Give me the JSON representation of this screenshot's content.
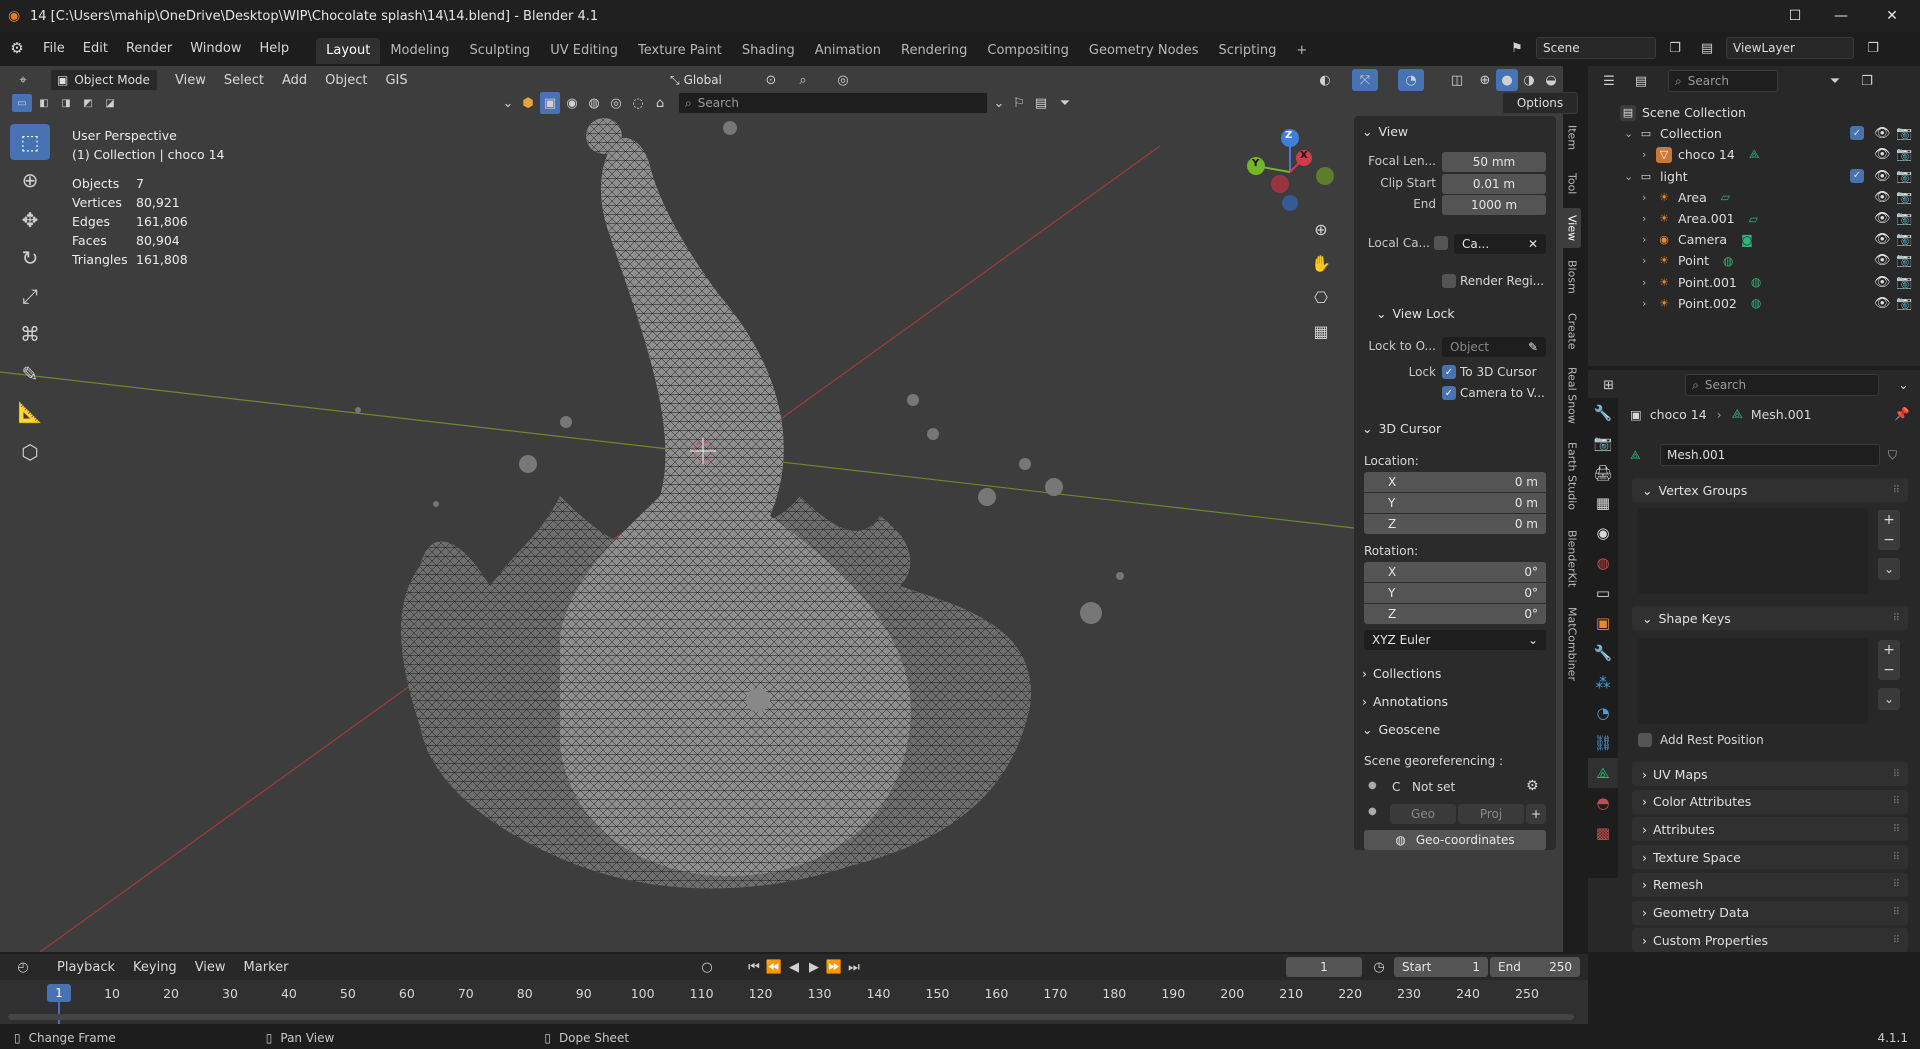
{
  "titlebar": {
    "title": "14 [C:\\Users\\mahip\\OneDrive\\Desktop\\WIP\\Chocolate splash\\14\\14.blend] - Blender 4.1",
    "minimize": "—",
    "maximize": "☐",
    "close": "✕"
  },
  "menu": {
    "items": [
      "File",
      "Edit",
      "Render",
      "Window",
      "Help"
    ],
    "workspaces": [
      "Layout",
      "Modeling",
      "Sculpting",
      "UV Editing",
      "Texture Paint",
      "Shading",
      "Animation",
      "Rendering",
      "Compositing",
      "Geometry Nodes",
      "Scripting"
    ],
    "add_tab": "+",
    "scene": "Scene",
    "view_layer": "ViewLayer"
  },
  "viewport_header": {
    "mode": "Object Mode",
    "menus": [
      "View",
      "Select",
      "Add",
      "Object",
      "GIS"
    ],
    "transform_orientation": "Global",
    "search_placeholder": "Search",
    "options": "Options"
  },
  "viewport": {
    "view_name": "User Perspective",
    "collection_info": "(1) Collection | choco 14",
    "stats": [
      {
        "k": "Objects",
        "v": "7"
      },
      {
        "k": "Vertices",
        "v": "80,921"
      },
      {
        "k": "Edges",
        "v": "161,806"
      },
      {
        "k": "Faces",
        "v": "80,904"
      },
      {
        "k": "Triangles",
        "v": "161,808"
      }
    ],
    "gizmo": {
      "z": "Z",
      "y": "Y",
      "x": "X"
    }
  },
  "npanel": {
    "view_title": "View",
    "focal_label": "Focal Len...",
    "focal_value": "50 mm",
    "clip_start_label": "Clip Start",
    "clip_start_value": "0.01 m",
    "end_label": "End",
    "end_value": "1000 m",
    "local_cam_label": "Local Ca...",
    "local_cam_value": "Ca...",
    "render_region": "Render Regi...",
    "view_lock_title": "View Lock",
    "lock_to_label": "Lock to O...",
    "lock_to_placeholder": "Object",
    "lock_label": "Lock",
    "to_3d_cursor": "To 3D Cursor",
    "camera_to_view": "Camera to V...",
    "cursor_title": "3D Cursor",
    "location_label": "Location:",
    "loc": [
      {
        "a": "X",
        "v": "0 m"
      },
      {
        "a": "Y",
        "v": "0 m"
      },
      {
        "a": "Z",
        "v": "0 m"
      }
    ],
    "rotation_label": "Rotation:",
    "rot": [
      {
        "a": "X",
        "v": "0°"
      },
      {
        "a": "Y",
        "v": "0°"
      },
      {
        "a": "Z",
        "v": "0°"
      }
    ],
    "rotation_mode": "XYZ Euler",
    "collections": "Collections",
    "annotations": "Annotations",
    "geoscene": "Geoscene",
    "georef_label": "Scene georeferencing :",
    "georef_c": "C",
    "georef_value": "Not set",
    "geo_btn": "Geo",
    "proj_btn": "Proj",
    "geo_coords": "Geo-coordinates",
    "tabs": [
      "Item",
      "Tool",
      "View",
      "Blosm",
      "Create",
      "Real Snow",
      "Earth Studio",
      "BlenderKit",
      "MatCombiner"
    ]
  },
  "outliner": {
    "search_placeholder": "Search",
    "rows": [
      {
        "label": "Scene Collection",
        "indent": 0,
        "icon": "scene-collection"
      },
      {
        "label": "Collection",
        "indent": 1,
        "icon": "collection"
      },
      {
        "label": "choco 14",
        "indent": 2,
        "icon": "mesh"
      },
      {
        "label": "light",
        "indent": 1,
        "icon": "collection"
      },
      {
        "label": "Area",
        "indent": 2,
        "icon": "light"
      },
      {
        "label": "Area.001",
        "indent": 2,
        "icon": "light"
      },
      {
        "label": "Camera",
        "indent": 2,
        "icon": "camera"
      },
      {
        "label": "Point",
        "indent": 2,
        "icon": "light"
      },
      {
        "label": "Point.001",
        "indent": 2,
        "icon": "light"
      },
      {
        "label": "Point.002",
        "indent": 2,
        "icon": "light"
      }
    ]
  },
  "properties": {
    "search_placeholder": "Search",
    "breadcrumb_object": "choco 14",
    "breadcrumb_data": "Mesh.001",
    "mesh_name": "Mesh.001",
    "vertex_groups": "Vertex Groups",
    "shape_keys": "Shape Keys",
    "add_rest_position": "Add Rest Position",
    "sections": [
      "UV Maps",
      "Color Attributes",
      "Attributes",
      "Texture Space",
      "Remesh",
      "Geometry Data",
      "Custom Properties"
    ]
  },
  "timeline": {
    "menus": [
      "Playback",
      "Keying",
      "View",
      "Marker"
    ],
    "current_frame": "1",
    "start_label": "Start",
    "start": "1",
    "end_label": "End",
    "end": "250",
    "ticks": [
      "10",
      "20",
      "30",
      "40",
      "50",
      "60",
      "70",
      "80",
      "90",
      "100",
      "110",
      "120",
      "130",
      "140",
      "150",
      "160",
      "170",
      "180",
      "190",
      "200",
      "210",
      "220",
      "230",
      "240",
      "250"
    ],
    "playhead": "1"
  },
  "statusbar": {
    "change_frame": "Change Frame",
    "pan_view": "Pan View",
    "dope_sheet": "Dope Sheet",
    "version": "4.1.1"
  },
  "colors": {
    "accent": "#4772b3",
    "blender_orange": "#e87d0d",
    "mesh_green": "#2fb37a"
  }
}
